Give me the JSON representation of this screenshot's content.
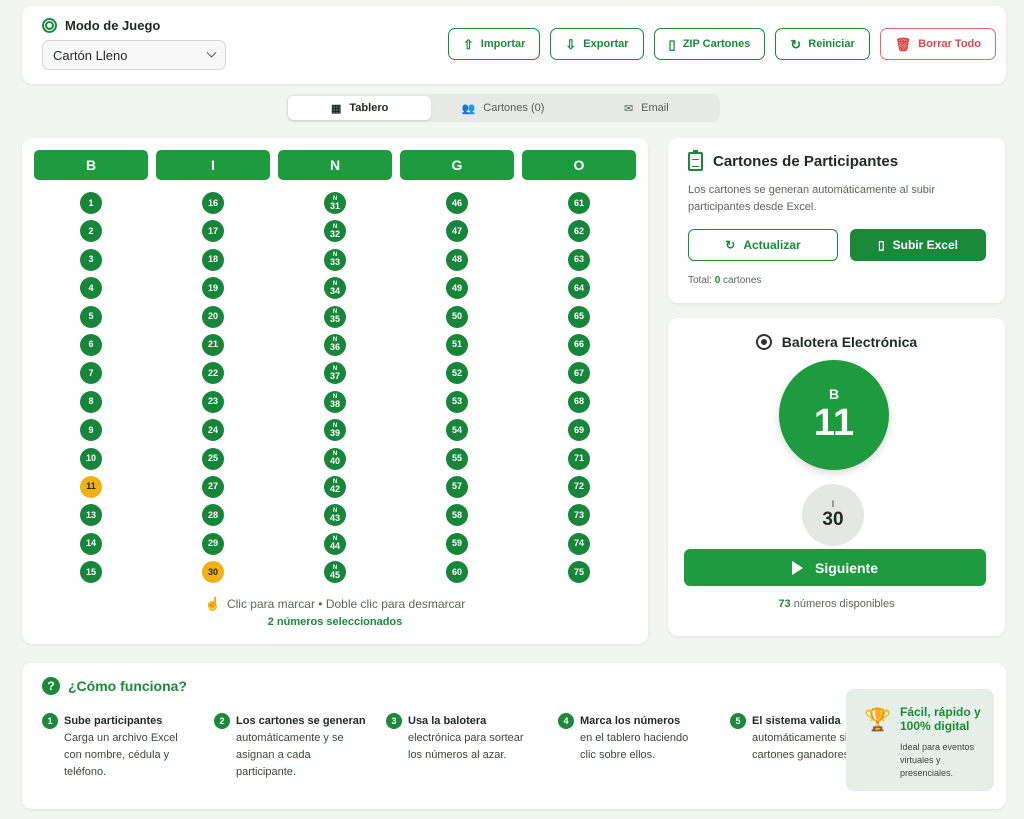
{
  "header": {
    "mode_label": "Modo de Juego",
    "mode_value": "Cartón Lleno",
    "actions": [
      "Importar",
      "Exportar",
      "ZIP Cartones",
      "Reiniciar",
      "Borrar Todo"
    ]
  },
  "tabs": [
    "Tablero",
    "Cartones (0)",
    "Email"
  ],
  "board": {
    "columns": [
      {
        "letter": "B",
        "numbers": [
          "1",
          "2",
          "3",
          "4",
          "5",
          "6",
          "7",
          "8",
          "9",
          "10",
          "11",
          "13",
          "14",
          "15"
        ],
        "selected": [
          "11"
        ]
      },
      {
        "letter": "I",
        "numbers": [
          "16",
          "17",
          "18",
          "19",
          "20",
          "21",
          "22",
          "23",
          "24",
          "25",
          "27",
          "28",
          "29",
          "30"
        ],
        "selected": [
          "30"
        ]
      },
      {
        "letter": "N",
        "numbers": [
          "31",
          "32",
          "33",
          "34",
          "35",
          "36",
          "37",
          "38",
          "39",
          "40",
          "42",
          "43",
          "44",
          "45"
        ],
        "selected": [],
        "prefix": "N"
      },
      {
        "letter": "G",
        "numbers": [
          "46",
          "47",
          "48",
          "49",
          "50",
          "51",
          "52",
          "53",
          "54",
          "55",
          "57",
          "58",
          "59",
          "60"
        ],
        "selected": []
      },
      {
        "letter": "O",
        "numbers": [
          "61",
          "62",
          "63",
          "64",
          "65",
          "66",
          "67",
          "68",
          "69",
          "71",
          "72",
          "73",
          "74",
          "75"
        ],
        "selected": []
      }
    ],
    "hint": "Clic para marcar • Doble clic para desmarcar",
    "selected_count": "2 números seleccionados"
  },
  "participants": {
    "title": "Cartones de Participantes",
    "description": "Los cartones se generan automáticamente al subir participantes desde Excel.",
    "refresh_label": "Actualizar",
    "upload_label": "Subir Excel",
    "total_prefix": "Total:",
    "total_count": "0",
    "total_suffix": "cartones"
  },
  "balotera": {
    "title": "Balotera Electrónica",
    "current_letter": "B",
    "current_number": "11",
    "previous_letter": "I",
    "previous_number": "30",
    "next_label": "Siguiente",
    "available_count": "73",
    "available_suffix": "números disponibles"
  },
  "how": {
    "title": "¿Cómo funciona?",
    "steps": [
      {
        "num": "1",
        "title": "Sube participantes",
        "desc": "Carga un archivo Excel con nombre, cédula y teléfono."
      },
      {
        "num": "2",
        "title": "Los cartones se generan",
        "desc": "automáticamente y se asignan a cada participante."
      },
      {
        "num": "3",
        "title": "Usa la balotera",
        "desc": "electrónica para sortear los números al azar."
      },
      {
        "num": "4",
        "title": "Marca los números",
        "desc": "en el tablero haciendo clic sobre ellos."
      },
      {
        "num": "5",
        "title": "El sistema valida",
        "desc": "automáticamente si hay cartones ganadores."
      }
    ],
    "promo_title": "Fácil, rápido y 100% digital",
    "promo_desc": "Ideal para eventos virtuales y presenciales."
  },
  "colors": {
    "accent": "#1a8a3a",
    "selected": "#f2b017",
    "danger": "#d84848"
  }
}
